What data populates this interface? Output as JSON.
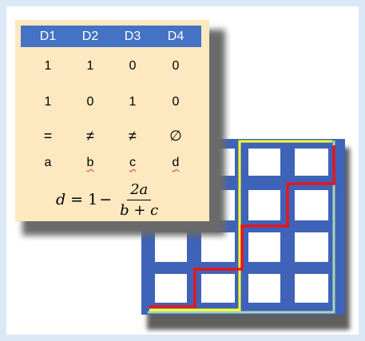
{
  "table": {
    "headers": [
      "D1",
      "D2",
      "D3",
      "D4"
    ],
    "rows": [
      [
        "1",
        "1",
        "0",
        "0"
      ],
      [
        "1",
        "0",
        "1",
        "0"
      ],
      [
        "=",
        "≠",
        "≠",
        "∅"
      ],
      [
        "a",
        "b",
        "c",
        "d"
      ]
    ]
  },
  "formula": {
    "lhs": "d",
    "eq": "=",
    "one": "1",
    "minus": "−",
    "numerator": "2a",
    "denominator": "b + c"
  },
  "colors": {
    "grid_blue": "#3f63b8",
    "card_bg": "#fde8c0",
    "header_blue": "#4472c4",
    "path_red": "#e8161b",
    "path_yellow": "#ffff2e",
    "path_green": "#a8d5b0"
  }
}
